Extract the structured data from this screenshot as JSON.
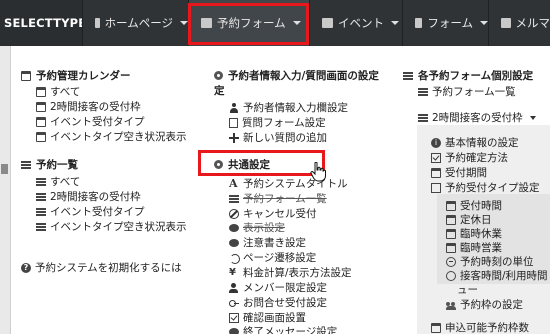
{
  "nav": {
    "brand": "SELECTTYPE",
    "items": [
      {
        "label": "ホームページ",
        "icon": "file-icon"
      },
      {
        "label": "予約フォーム",
        "icon": "calendar-icon"
      },
      {
        "label": "イベント",
        "icon": "comment-icon"
      },
      {
        "label": "フォーム",
        "icon": "list-icon"
      },
      {
        "label": "メルマ",
        "icon": "mail-icon"
      }
    ]
  },
  "col1": {
    "cal_heading": "予約管理カレンダー",
    "cal_items": [
      "すべて",
      "2時間接客の受付枠",
      "イベント受付タイプ",
      "イベントタイプ空き状況表示"
    ],
    "list_heading": "予約一覧",
    "list_items": [
      "すべて",
      "2時間接客の受付枠",
      "イベント受付タイプ",
      "イベントタイプ空き状況表示"
    ],
    "reset_link": "予約システムを初期化するには"
  },
  "col2": {
    "input_heading": "予約者情報入力/質問画面の設定",
    "input_heading_line2": "定",
    "input_items": [
      "予約者情報入力欄設定",
      "質問フォーム設定",
      "新しい質問の追加"
    ],
    "common_heading": "共通設定",
    "common_items": [
      "予約システムタイトル",
      "予約フォーム一覧",
      "キャンセル受付",
      "表示設定",
      "注意書き設定",
      "ページ遷移設定",
      "料金計算/表示方法設定",
      "メンバー限定設定",
      "お問合せ受付設定",
      "確認画面設置",
      "終了メッセージ設定"
    ]
  },
  "col3": {
    "heading": "各予約フォーム個別設定",
    "top_link": "予約フォーム一覧",
    "selected_form": "2時間接客の受付枠",
    "form_items": [
      "基本情報の設定",
      "予約確定方法",
      "受付期間",
      "予約受付タイプ設定"
    ],
    "sub_items": [
      "受付時間",
      "定休日",
      "臨時休業",
      "臨時営業",
      "予約時刻の単位",
      "接客時間/利用時間",
      "ュー",
      "予約枠の設定"
    ],
    "bottom_link": "申込可能予約枠数"
  }
}
